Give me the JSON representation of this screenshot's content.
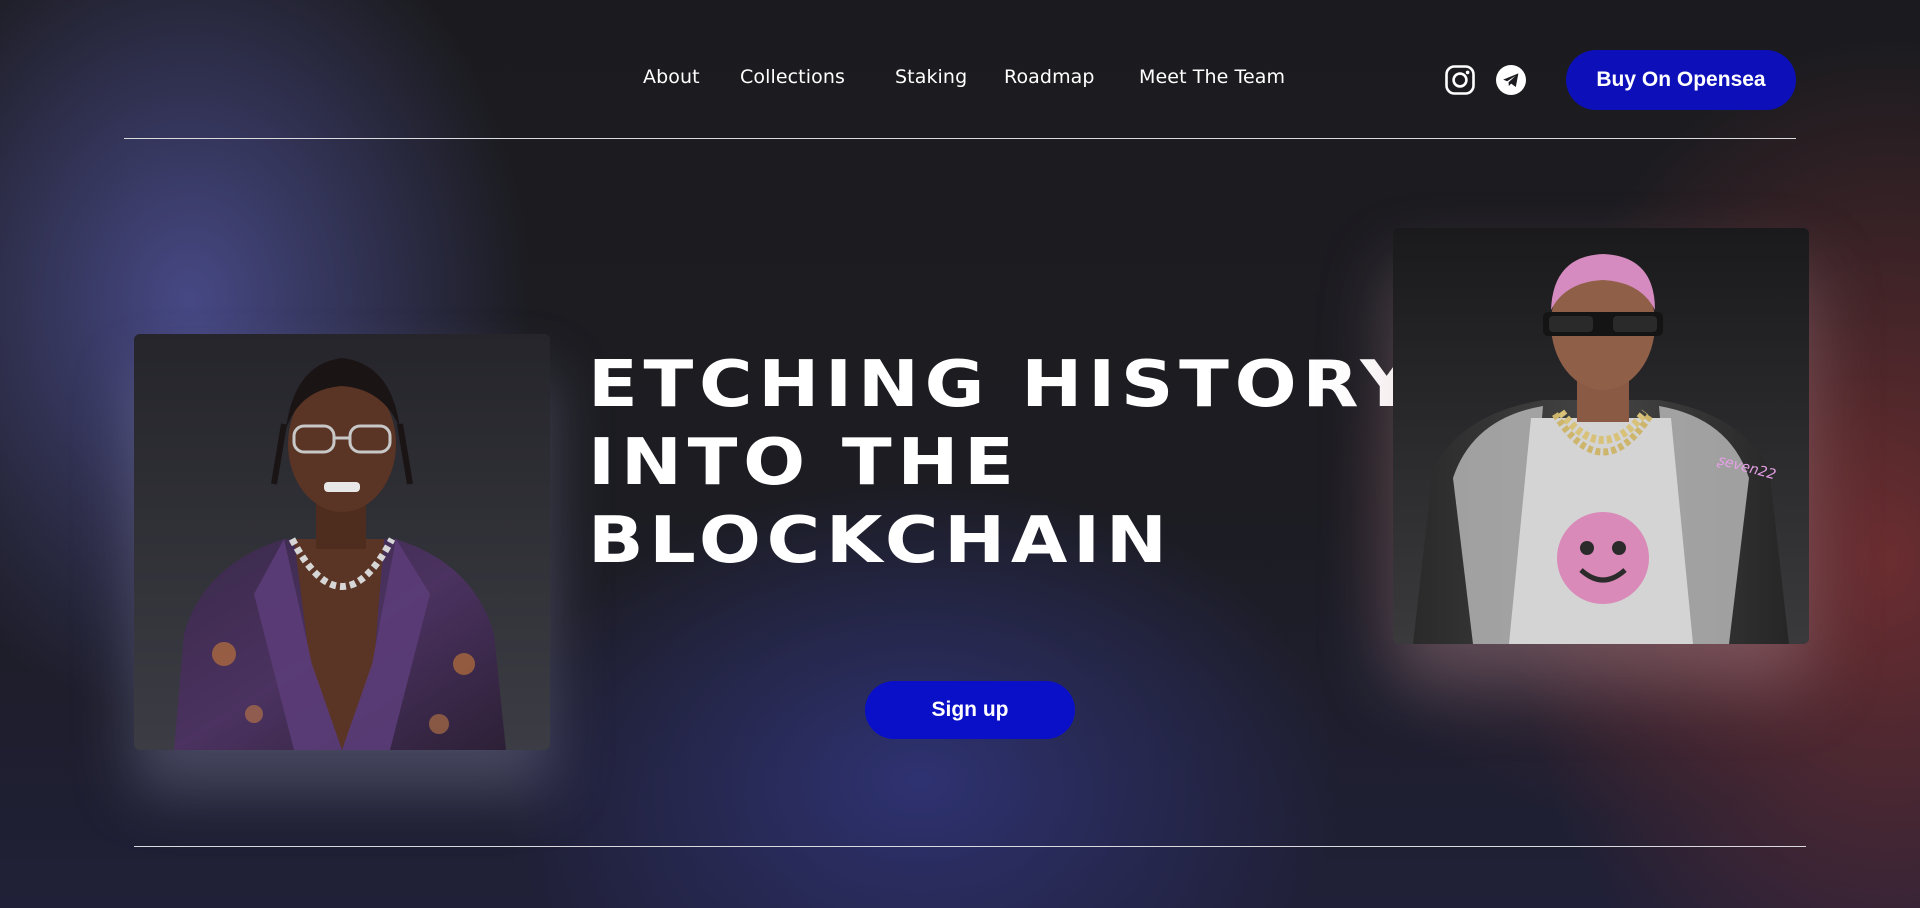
{
  "nav": {
    "items": [
      {
        "label": "About"
      },
      {
        "label": "Collections"
      },
      {
        "label": "Staking"
      },
      {
        "label": "Roadmap"
      },
      {
        "label": "Meet The Team"
      }
    ],
    "social_icons": [
      "instagram-icon",
      "telegram-icon"
    ],
    "buy_button": "Buy On Opensea"
  },
  "hero": {
    "title_lines": [
      "ETCHING HISTORY",
      "INTO THE",
      "BLOCKCHAIN"
    ],
    "signup_button": "Sign up"
  },
  "nft_images": [
    {
      "name": "left-nft-avatar",
      "signature": ""
    },
    {
      "name": "right-nft-avatar",
      "signature": "ʂeven22"
    }
  ],
  "colors": {
    "button_primary": "#0d10b8",
    "divider": "#d9d9de",
    "text": "#ffffff"
  }
}
